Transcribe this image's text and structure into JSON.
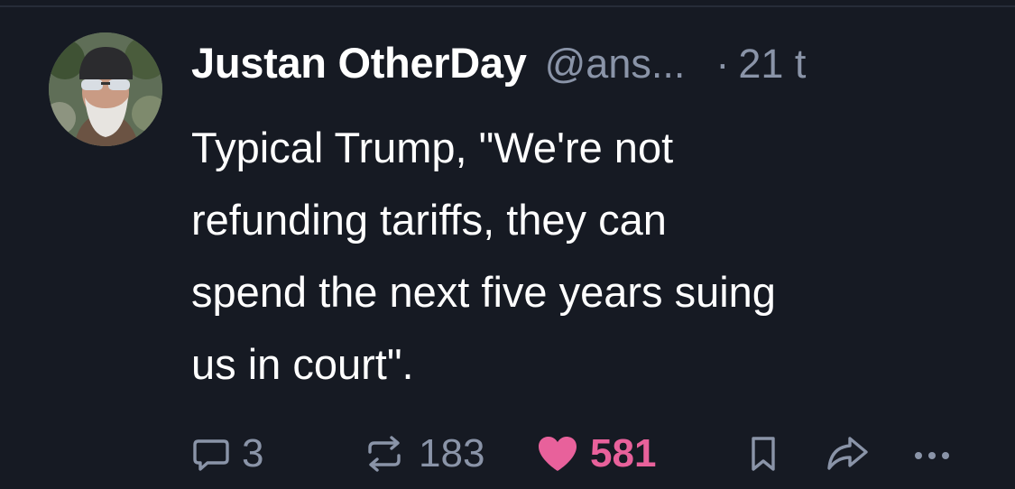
{
  "post": {
    "author": {
      "display_name": "Justan OtherDay",
      "handle": "@ans...",
      "avatar_icon": "bearded-man-sunglasses-avatar"
    },
    "time_separator": "·",
    "timestamp": "21 t",
    "text_lines": [
      "Typical Trump, \"We're not",
      "refunding tariffs, they can",
      "spend the next five years suing",
      "us in court\"."
    ],
    "actions": {
      "reply": {
        "icon": "reply-bubble-icon",
        "count": "3"
      },
      "repost": {
        "icon": "repost-icon",
        "count": "183"
      },
      "like": {
        "icon": "heart-icon",
        "count": "581",
        "liked": true
      },
      "bookmark": {
        "icon": "bookmark-icon"
      },
      "share": {
        "icon": "share-arrow-icon"
      },
      "more": {
        "icon": "more-dots-icon"
      }
    }
  },
  "colors": {
    "background": "#161a23",
    "text": "#ffffff",
    "muted": "#8a94a8",
    "like_accent": "#e8619b"
  }
}
